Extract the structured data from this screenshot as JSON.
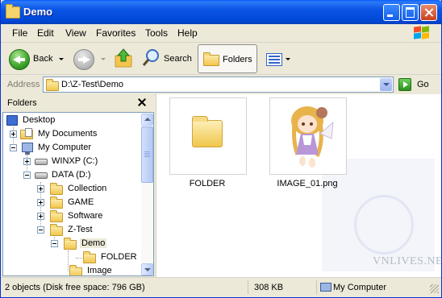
{
  "window": {
    "title": "Demo"
  },
  "menu": [
    "File",
    "Edit",
    "View",
    "Favorites",
    "Tools",
    "Help"
  ],
  "toolbar": {
    "back_label": "Back",
    "search_label": "Search",
    "folders_label": "Folders"
  },
  "address": {
    "label": "Address",
    "value": "D:\\Z-Test\\Demo",
    "go_label": "Go"
  },
  "folders_pane": {
    "title": "Folders",
    "tree": [
      {
        "label": "Desktop",
        "icon": "desktop-icon"
      },
      {
        "label": "My Documents",
        "icon": "documents-folder-icon",
        "expander": "plus"
      },
      {
        "label": "My Computer",
        "icon": "computer-icon",
        "expander": "minus"
      },
      {
        "label": "WINXP (C:)",
        "icon": "drive-icon",
        "expander": "plus"
      },
      {
        "label": "DATA (D:)",
        "icon": "drive-icon",
        "expander": "minus"
      },
      {
        "label": "Collection",
        "icon": "folder-icon",
        "expander": "plus"
      },
      {
        "label": "GAME",
        "icon": "folder-icon",
        "expander": "plus"
      },
      {
        "label": "Software",
        "icon": "folder-icon",
        "expander": "plus"
      },
      {
        "label": "Z-Test",
        "icon": "folder-icon",
        "expander": "minus"
      },
      {
        "label": "Demo",
        "icon": "open-folder-icon",
        "expander": "minus",
        "selected": true
      },
      {
        "label": "FOLDER",
        "icon": "folder-icon"
      },
      {
        "label": "Image",
        "icon": "folder-icon"
      }
    ]
  },
  "content": {
    "items": [
      {
        "name": "FOLDER",
        "type": "folder"
      },
      {
        "name": "IMAGE_01.png",
        "type": "image"
      }
    ],
    "watermark": "VNLIVES.NET"
  },
  "status": {
    "objects": "2 objects (Disk free space: 796 GB)",
    "size": "308 KB",
    "location": "My Computer"
  }
}
